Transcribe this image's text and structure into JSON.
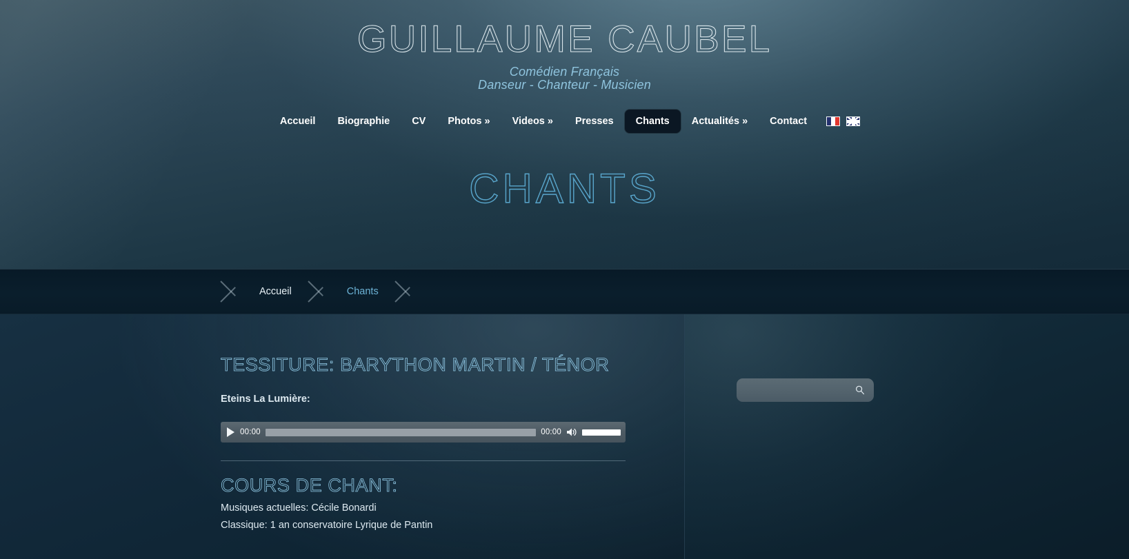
{
  "site": {
    "title": "GUILLAUME CAUBEL",
    "tagline_line1": "Comédien Français",
    "tagline_line2": "Danseur - Chanteur - Musicien"
  },
  "nav": {
    "items": [
      {
        "label": "Accueil",
        "active": false
      },
      {
        "label": "Biographie",
        "active": false
      },
      {
        "label": "CV",
        "active": false
      },
      {
        "label": "Photos »",
        "active": false
      },
      {
        "label": "Videos »",
        "active": false
      },
      {
        "label": "Presses",
        "active": false
      },
      {
        "label": "Chants",
        "active": true
      },
      {
        "label": "Actualités »",
        "active": false
      },
      {
        "label": "Contact",
        "active": false
      }
    ],
    "flags": [
      {
        "name": "flag-fr-icon",
        "title": "Français"
      },
      {
        "name": "flag-uk-icon",
        "title": "English"
      }
    ]
  },
  "page": {
    "title": "CHANTS"
  },
  "breadcrumb": {
    "items": [
      {
        "label": "Accueil",
        "current": false
      },
      {
        "label": "Chants",
        "current": true
      }
    ]
  },
  "main": {
    "heading_tessiture": "TESSITURE: BARYTHON MARTIN / TÉNOR",
    "track_label": "Eteins La Lumière:",
    "player": {
      "current_time": "00:00",
      "duration": "00:00",
      "play_icon": "play-icon",
      "volume_icon": "speaker-icon"
    },
    "heading_cours": "COURS DE CHANT:",
    "paragraphs": [
      "Musiques actuelles: Cécile Bonardi",
      "Classique: 1 an conservatoire Lyrique de Pantin"
    ]
  },
  "sidebar": {
    "search": {
      "value": "",
      "placeholder": "",
      "icon": "search-icon"
    }
  },
  "colors": {
    "accent_blue": "#6db3d6",
    "heading_outline": "#8ec6e2",
    "page_title_outline": "#59a6cc",
    "text_light": "#dde9f0",
    "nav_active_bg": "#0b1723"
  }
}
